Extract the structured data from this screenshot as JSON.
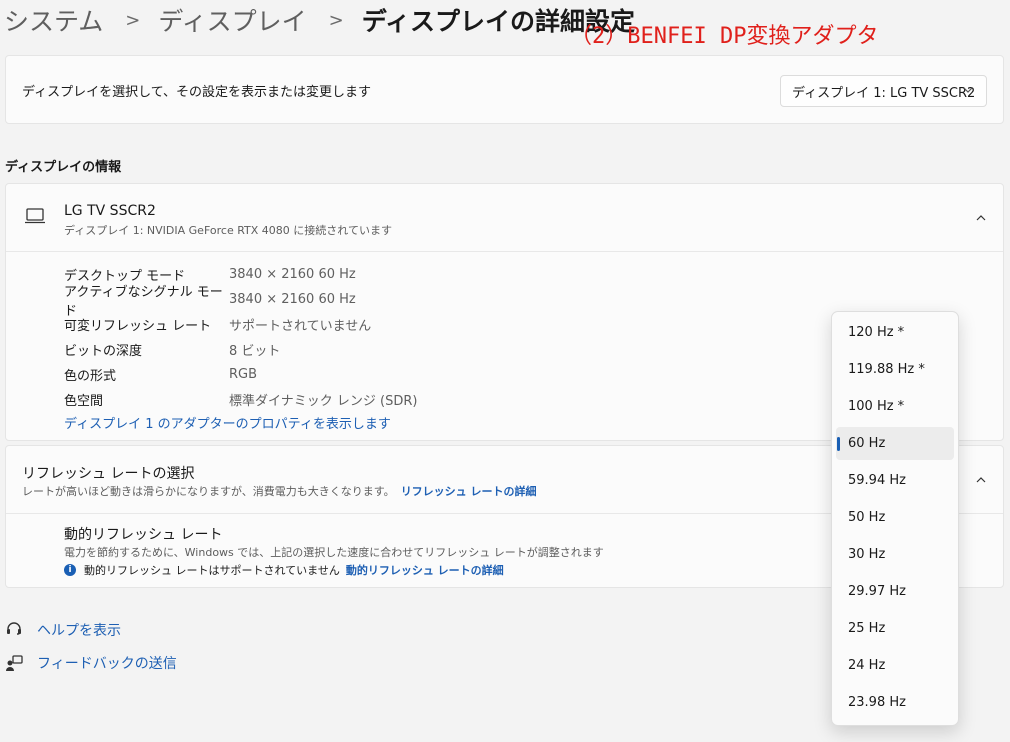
{
  "breadcrumb": {
    "items": [
      "システム",
      "ディスプレイ"
    ],
    "current": "ディスプレイの詳細設定"
  },
  "annotation": "（2）BENFEI DP変換アダプタ",
  "select_display": {
    "label": "ディスプレイを選択して、その設定を表示または変更します",
    "selected": "ディスプレイ 1: LG TV SSCR2"
  },
  "info_section": {
    "title": "ディスプレイの情報",
    "device_name": "LG TV SSCR2",
    "device_sub": "ディスプレイ 1: NVIDIA GeForce RTX 4080 に接続されています",
    "rows": [
      {
        "key": "デスクトップ モード",
        "value": "3840 × 2160 60 Hz"
      },
      {
        "key": "アクティブなシグナル モード",
        "value": "3840 × 2160 60 Hz"
      },
      {
        "key": "可変リフレッシュ レート",
        "value": "サポートされていません"
      },
      {
        "key": "ビットの深度",
        "value": "8 ビット"
      },
      {
        "key": "色の形式",
        "value": "RGB"
      },
      {
        "key": "色空間",
        "value": "標準ダイナミック レンジ (SDR)"
      }
    ],
    "adapter_link": "ディスプレイ 1 のアダプターのプロパティを表示します"
  },
  "refresh": {
    "title": "リフレッシュ レートの選択",
    "subtitle": "レートが高いほど動きは滑らかになりますが、消費電力も大きくなります。",
    "detail_link": "リフレッシュ レートの詳細",
    "dynamic_title": "動的リフレッシュ レート",
    "dynamic_sub": "電力を節約するために、Windows では、上記の選択した速度に合わせてリフレッシュ レートが調整されます",
    "dynamic_info": "動的リフレッシュ レートはサポートされていません",
    "dynamic_link": "動的リフレッシュ レートの詳細"
  },
  "footer": {
    "help": "ヘルプを表示",
    "feedback": "フィードバックの送信"
  },
  "refresh_menu": {
    "selected": "60 Hz",
    "options": [
      "120 Hz *",
      "119.88 Hz *",
      "100 Hz *",
      "60 Hz",
      "59.94 Hz",
      "50 Hz",
      "30 Hz",
      "29.97 Hz",
      "25 Hz",
      "24 Hz",
      "23.98 Hz"
    ]
  },
  "colors": {
    "accent": "#1a5fb4",
    "link": "#1d5fb3",
    "annotation": "#e0201b",
    "background": "#f3f3f3"
  }
}
